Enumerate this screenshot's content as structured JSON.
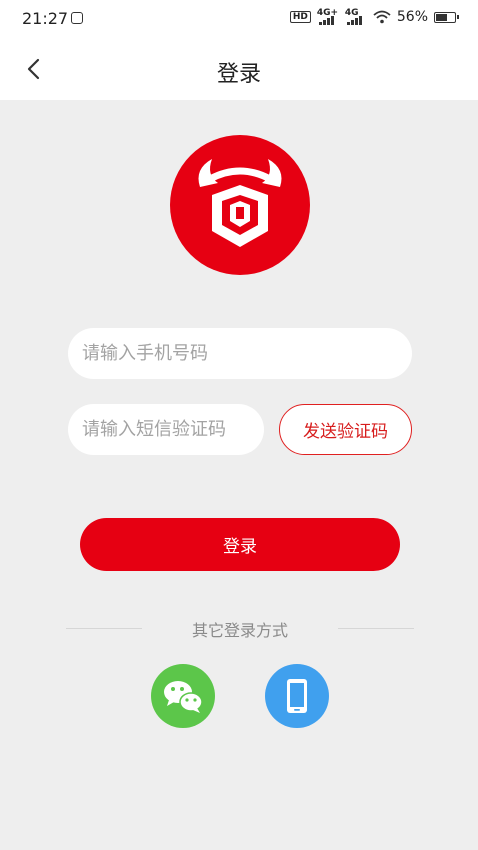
{
  "status_bar": {
    "time": "21:27",
    "hd_label": "HD",
    "signal1_label": "4G+",
    "signal2_label": "4G",
    "battery_text": "56%",
    "battery_level": 0.56
  },
  "nav": {
    "title": "登录",
    "back_icon": "chevron-left-icon"
  },
  "logo": {
    "icon": "bull-logo-icon",
    "color": "#e60012"
  },
  "form": {
    "phone_placeholder": "请输入手机号码",
    "code_placeholder": "请输入短信验证码",
    "send_code_label": "发送验证码",
    "login_label": "登录"
  },
  "other_login": {
    "divider_text": "其它登录方式",
    "wechat_icon": "wechat-icon",
    "phone_icon": "phone-icon"
  },
  "colors": {
    "brand_red": "#e60012",
    "wechat_green": "#5cc64a",
    "phone_blue": "#40a0ee",
    "background": "#eeeeee"
  }
}
